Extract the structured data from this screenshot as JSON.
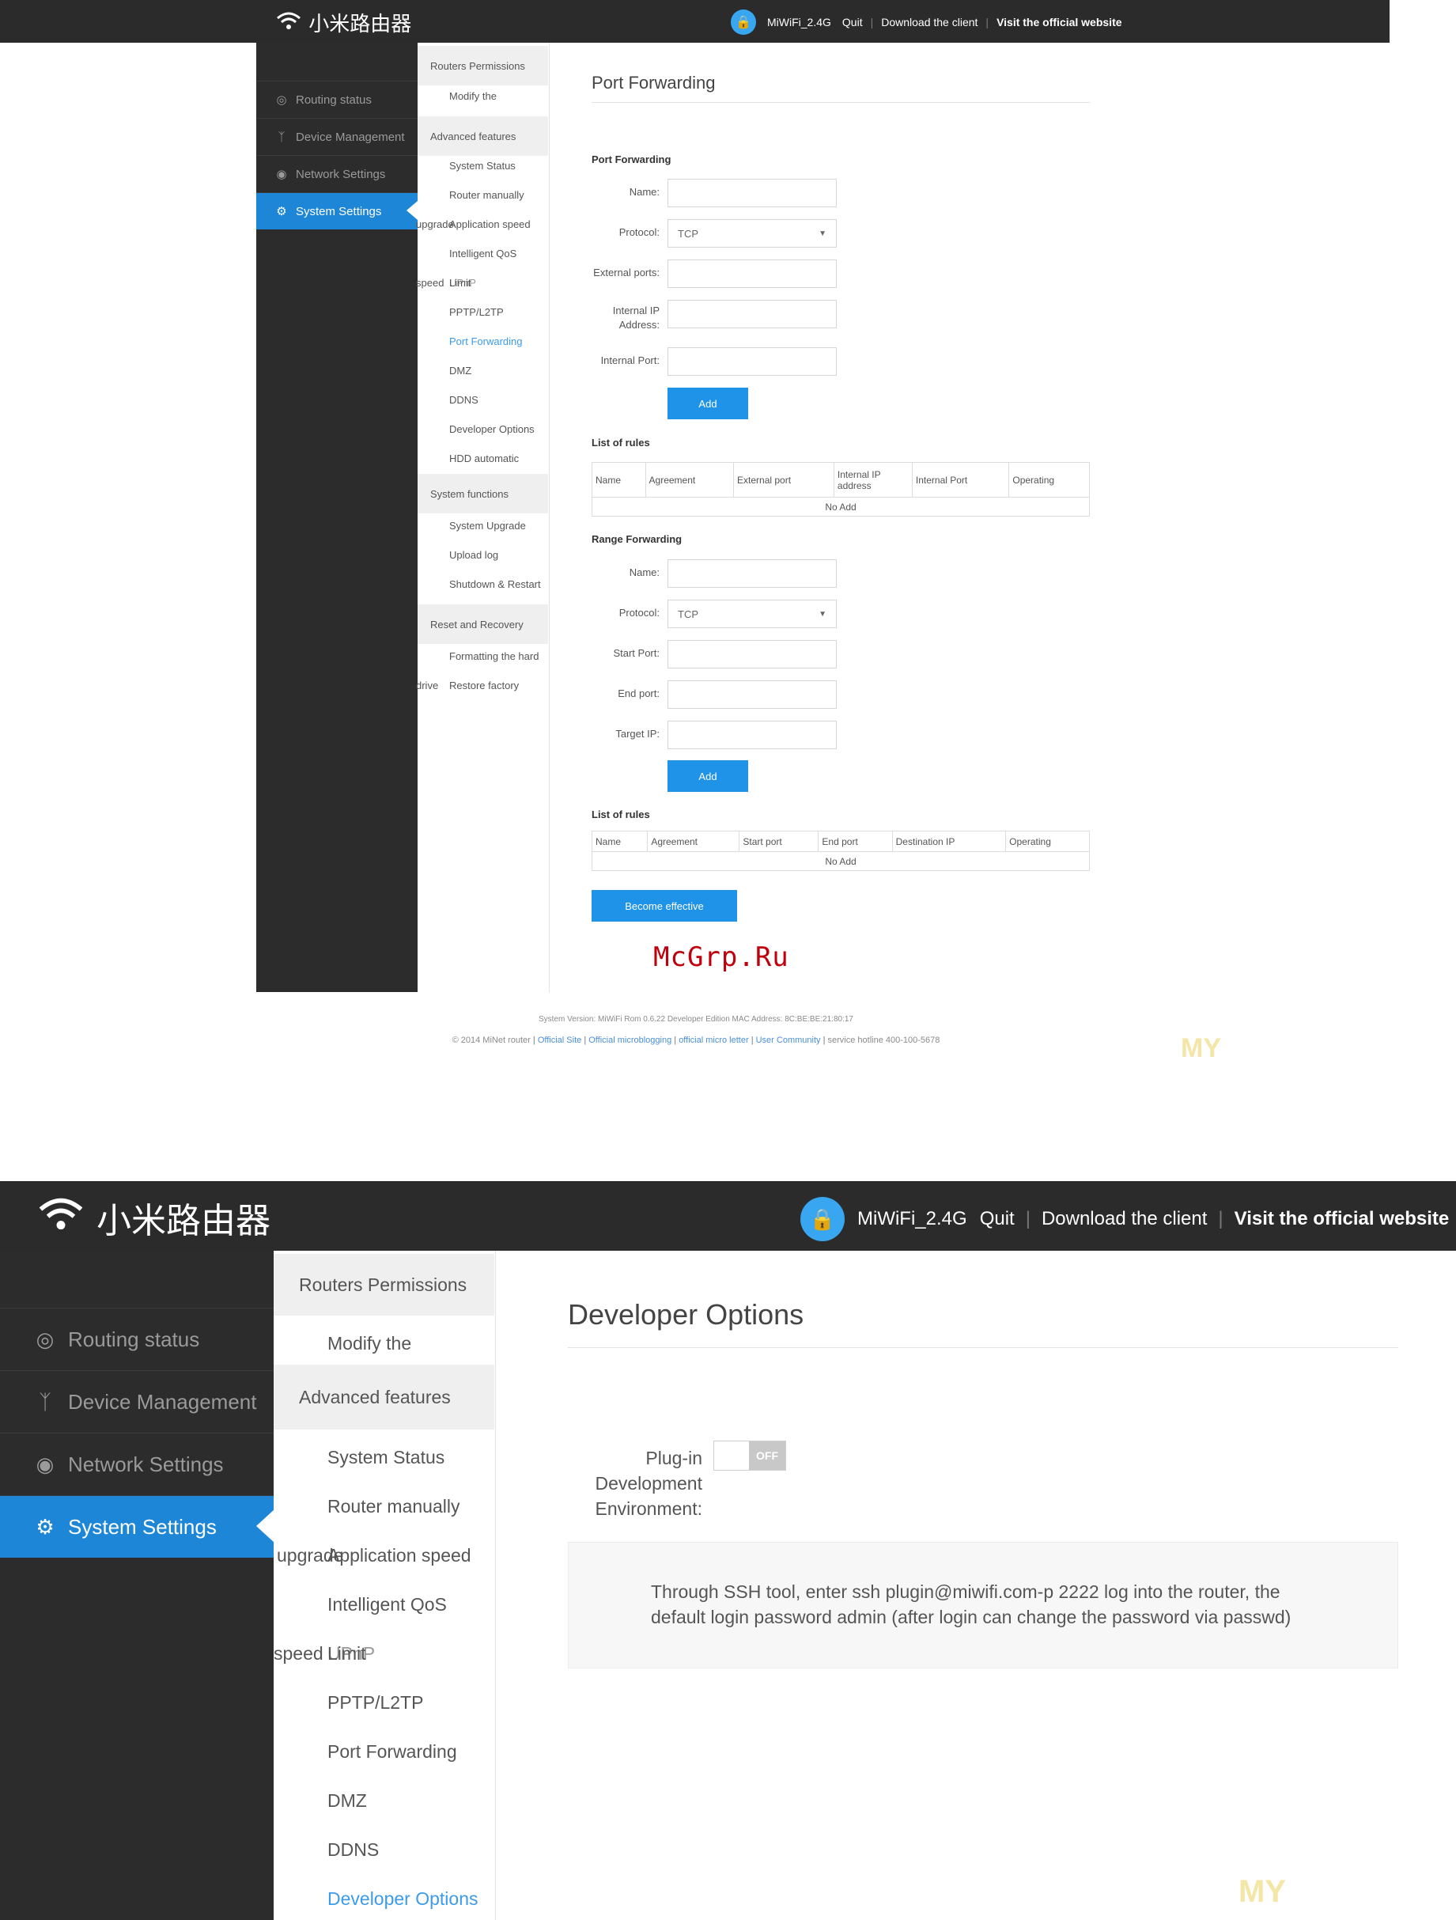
{
  "header": {
    "brand": "小米路由器",
    "network": "MiWiFi_2.4G",
    "quit": "Quit",
    "download": "Download the client",
    "official": "Visit the official website"
  },
  "sidebar": {
    "items": [
      {
        "label": "Routing status",
        "icon": "routing-status-icon"
      },
      {
        "label": "Device Management",
        "icon": "person-icon"
      },
      {
        "label": "Network Settings",
        "icon": "globe-icon"
      },
      {
        "label": "System Settings",
        "icon": "gear-icon"
      }
    ]
  },
  "submenu": {
    "routers_permissions": "Routers Permissions",
    "modify_the": "Modify the",
    "advanced_features": "Advanced features",
    "system_status": "System Status",
    "router_manually": "Router manually",
    "application_speed": "Application speed",
    "upgrade_stray": "upgrade",
    "intelligent_qos": "Intelligent QoS",
    "speed_stray": "speed",
    "limit": "Limit",
    "upnp": "UPnP",
    "pptp": "PPTP/L2TP",
    "port_forwarding": "Port Forwarding",
    "dmz": "DMZ",
    "ddns": "DDNS",
    "developer_options": "Developer Options",
    "hdd_automatic": "HDD automatic",
    "system_functions": "System functions",
    "system_upgrade": "System Upgrade",
    "upload_log": "Upload log",
    "shutdown_restart": "Shutdown & Restart",
    "reset_recovery": "Reset and Recovery",
    "formatting_hard": "Formatting the hard",
    "drive_stray": "drive",
    "restore_factory": "Restore factory"
  },
  "port_forwarding_page": {
    "title": "Port Forwarding",
    "section_port": "Port Forwarding",
    "name_label": "Name:",
    "protocol_label": "Protocol:",
    "protocol_value": "TCP",
    "external_ports_label": "External ports:",
    "internal_ip_label": "Internal IP Address:",
    "internal_port_label": "Internal Port:",
    "add": "Add",
    "list_of_rules": "List of rules",
    "table1_headers": [
      "Name",
      "Agreement",
      "External port",
      "Internal IP address",
      "Internal Port",
      "Operating"
    ],
    "no_add": "No Add",
    "section_range": "Range Forwarding",
    "start_port_label": "Start Port:",
    "end_port_label": "End port:",
    "target_ip_label": "Target IP:",
    "table2_headers": [
      "Name",
      "Agreement",
      "Start port",
      "End port",
      "Destination IP",
      "Operating"
    ],
    "become_effective": "Become effective",
    "footer_version": "System Version: MiWiFi Rom 0.6.22 Developer Edition MAC Address: 8C:BE:BE:21:80:17",
    "footer_copy": "© 2014 MiNet router",
    "footer_links": [
      "Official Site",
      "Official microblogging",
      "official micro letter",
      "User Community"
    ],
    "footer_hotline": "service hotline 400-100-5678"
  },
  "developer_page": {
    "title": "Developer Options",
    "plugin_label": "Plug-in Development Environment:",
    "toggle_state": "OFF",
    "info_text": "Through SSH tool, enter ssh plugin@miwifi.com-p 2222 log into the router, the default login password admin (after login can change the password via passwd)"
  },
  "watermark": "McGrp.Ru",
  "faint_mark": "MY",
  "colors": {
    "topbar": "#2b2b2b",
    "sidebar": "#2c2c2c",
    "active": "#1e86d6",
    "button": "#1e93e8",
    "link": "#3d9be9",
    "watermark": "#c0000d"
  }
}
